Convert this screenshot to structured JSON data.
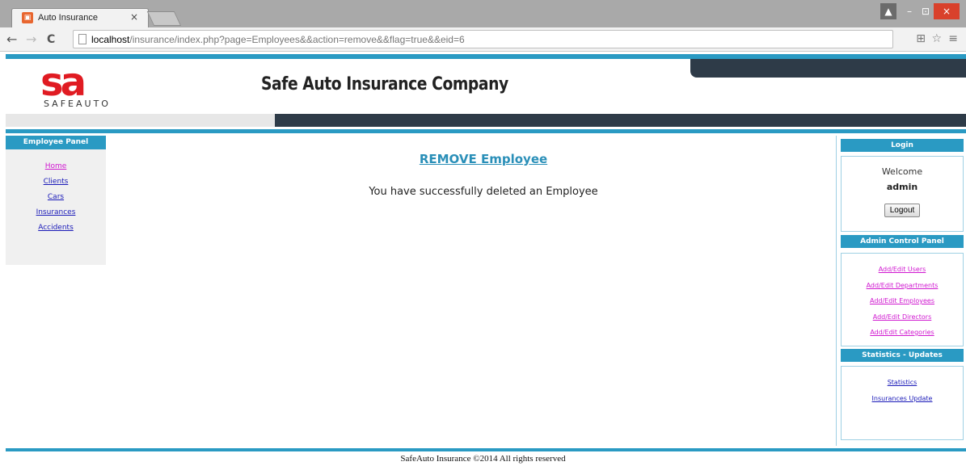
{
  "browser": {
    "tab_title": "Auto Insurance",
    "tab_close": "×",
    "back": "←",
    "forward": "→",
    "reload": "C",
    "url_host": "localhost",
    "url_path": "/insurance/index.php?page=Employees&&action=remove&&flag=true&&eid=6",
    "star": "☆",
    "menu": "≡",
    "translate": "⊞",
    "win_min": "–",
    "win_max": "⊡",
    "win_close": "×",
    "win_user": "▲"
  },
  "header": {
    "logo_mark": "sa",
    "logo_word": "SAFEAUTO",
    "site_title": "Safe Auto Insurance Company"
  },
  "left_panel": {
    "title": "Employee Panel",
    "links": [
      "Home",
      "Clients",
      "Cars",
      "Insurances",
      "Accidents"
    ]
  },
  "main": {
    "title": "REMOVE Employee",
    "message": "You have successfully deleted an Employee"
  },
  "login_box": {
    "title": "Login",
    "welcome": "Welcome",
    "username": "admin",
    "logout_label": "Logout"
  },
  "admin_panel": {
    "title": "Admin Control Panel",
    "links": [
      "Add/Edit Users",
      "Add/Edit Departments",
      "Add/Edit Employees",
      "Add/Edit Directors",
      "Add/Edit Categories"
    ]
  },
  "stats_panel": {
    "title": "Statistics - Updates",
    "links": [
      "Statistics",
      "Insurances Update"
    ]
  },
  "footer": {
    "text": "SafeAuto Insurance ©2014 All rights reserved"
  },
  "colors": {
    "accent_blue": "#2a9ac3",
    "dark_bar": "#2e3b48",
    "brand_red": "#e01b22",
    "link_blue": "#1a1ab8",
    "link_visited": "#d017d0"
  }
}
